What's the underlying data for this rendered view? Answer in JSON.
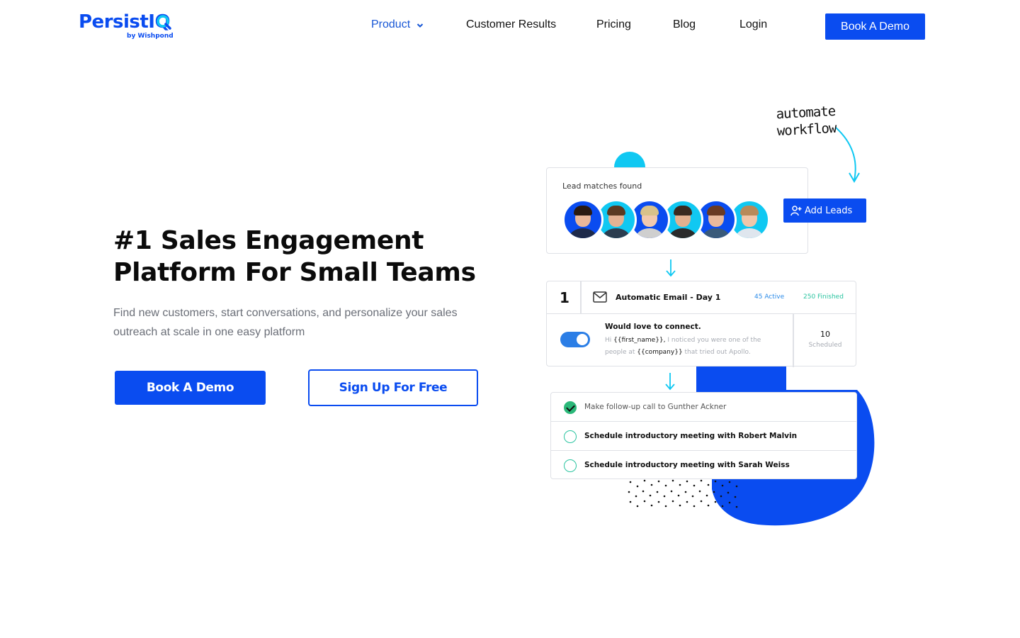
{
  "header": {
    "logo": {
      "name": "PersistIQ",
      "sub": "by Wishpond"
    },
    "nav": [
      {
        "label": "Product",
        "active": true,
        "has_dropdown": true,
        "icon": "chevron-down-icon"
      },
      {
        "label": "Customer Results"
      },
      {
        "label": "Pricing"
      },
      {
        "label": "Blog"
      },
      {
        "label": "Login"
      }
    ],
    "cta_label": "Book A Demo"
  },
  "hero": {
    "title_line1": "#1 Sales Engagement",
    "title_line2": "Platform For Small Teams",
    "subtitle": "Find new customers, start conversations, and personalize your sales outreach at scale in one easy platform",
    "primary_label": "Book A Demo",
    "secondary_label": "Sign Up For Free"
  },
  "illustration": {
    "annotation_line1": "automate",
    "annotation_line2": "workflow",
    "leads_card": {
      "label": "Lead matches found",
      "avatars": [
        {
          "icon": "person-avatar",
          "skin": "#e9b79a",
          "hair": "#2a1a12",
          "shirt": "#1e2a4a"
        },
        {
          "icon": "person-avatar",
          "skin": "#e3b293",
          "hair": "#5a3a22",
          "shirt": "#2c3e50"
        },
        {
          "icon": "person-avatar",
          "skin": "#f1c9ae",
          "hair": "#d9c28a",
          "shirt": "#cfcfcf"
        },
        {
          "icon": "person-avatar",
          "skin": "#e2b08f",
          "hair": "#3a2a20",
          "shirt": "#2b2b2b"
        },
        {
          "icon": "person-avatar",
          "skin": "#e9b99c",
          "hair": "#6a3b24",
          "shirt": "#3a5a7a"
        },
        {
          "icon": "person-avatar",
          "skin": "#f0c6aa",
          "hair": "#b88a5a",
          "shirt": "#dfe6ee"
        }
      ],
      "add_leads_label": "Add Leads"
    },
    "email_card": {
      "step": "1",
      "title": "Automatic Email - Day 1",
      "active": "45 Active",
      "finished": "250 Finished",
      "toggle_on": true,
      "message_title": "Would love to connect.",
      "message_prefix": "Hi ",
      "message_var1": "{{first_name}},",
      "message_mid": " I noticed you were one of the people at ",
      "message_var2": "{{company}}",
      "message_suffix": " that tried out Apollo.",
      "scheduled_count": "10",
      "scheduled_label": "Scheduled"
    },
    "tasks": [
      {
        "label": "Make follow-up call to Gunther Ackner",
        "done": true
      },
      {
        "label": "Schedule introductory meeting with Robert Malvin",
        "done": false
      },
      {
        "label": "Schedule introductory meeting with Sarah Weiss",
        "done": false
      }
    ],
    "colors": {
      "brand_blue": "#0a4cf0",
      "cyan": "#10c8f2",
      "green": "#2bb879"
    }
  }
}
